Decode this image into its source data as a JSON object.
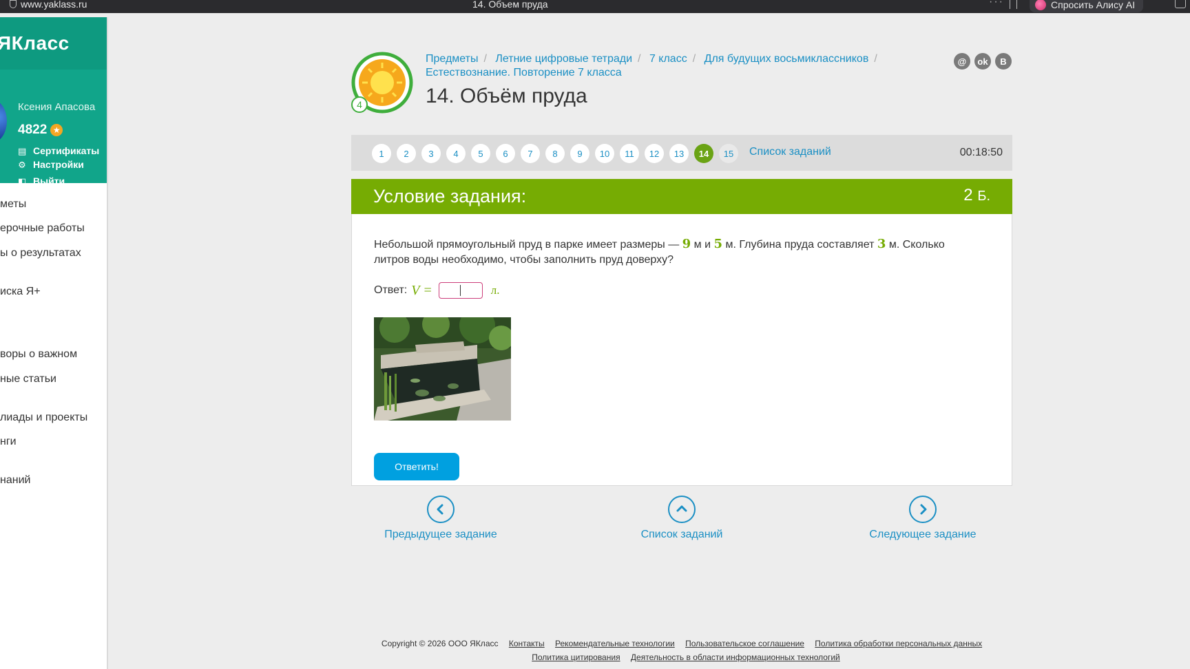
{
  "browser": {
    "url": "www.yaklass.ru",
    "tab_title": "14. Объем пруда",
    "alice_label": "Спросить Алису AI"
  },
  "sidebar": {
    "logo": "ЯКласс",
    "user_name": "Ксения Апасова",
    "points": "4822",
    "links": [
      "Сертификаты",
      "Настройки",
      "Выйти"
    ],
    "menu": [
      "меты",
      "ерочные работы",
      "ы о результатах",
      "иска Я+",
      "",
      "воры о важном",
      "ные статьи",
      "лиады и проекты",
      "нги",
      "наний"
    ]
  },
  "header": {
    "badge_level": "4",
    "breadcrumb": [
      "Предметы",
      "Летние цифровые тетради",
      "7 класс",
      "Для будущих восьмиклассников",
      "Естествознание. Повторение 7 класса"
    ],
    "title": "14. Объём пруда",
    "socials": [
      "@",
      "ok",
      "B"
    ]
  },
  "task_bar": {
    "numbers": [
      "1",
      "2",
      "3",
      "4",
      "5",
      "6",
      "7",
      "8",
      "9",
      "10",
      "11",
      "12",
      "13",
      "14",
      "15"
    ],
    "active": "14",
    "list_link": "Список заданий",
    "timer": "00:18:50"
  },
  "condition": {
    "header": "Условие задания:",
    "points": "2",
    "points_unit": "Б.",
    "text_part1": "Небольшой прямоугольный пруд в парке имеет размеры —",
    "n1": "9",
    "text_part2": "м и",
    "n2": "5",
    "text_part3": "м. Глубина пруда составляет",
    "n3": "3",
    "text_part4": "м. Сколько литров воды необходимо, чтобы заполнить пруд доверху?",
    "answer_label": "Ответ:",
    "variable": "V",
    "equals": "=",
    "answer_value": "",
    "unit": "л.",
    "submit": "Ответить!"
  },
  "nav": {
    "prev": "Предыдущее задание",
    "list": "Список заданий",
    "next": "Следующее задание"
  },
  "footer": {
    "copyright": "Copyright © 2026 ООО ЯКласс",
    "links_row1": [
      "Контакты",
      "Рекомендательные технологии",
      "Пользовательское соглашение",
      "Политика обработки персональных данных"
    ],
    "links_row2": [
      "Политика цитирования",
      "Деятельность в области информационных технологий"
    ]
  },
  "colors": {
    "teal": "#11a58a",
    "green": "#76ac03",
    "link_blue": "#1a8fc4",
    "button_blue": "#00a0e0"
  }
}
